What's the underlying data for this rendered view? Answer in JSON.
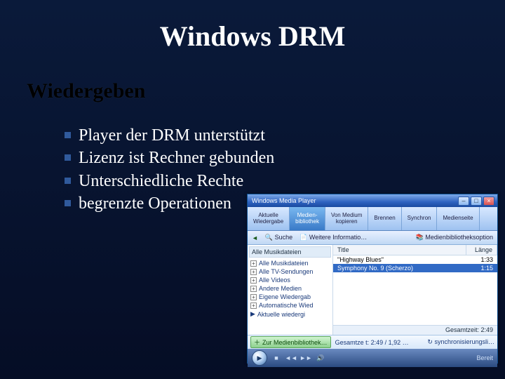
{
  "slide": {
    "title": "Windows DRM",
    "subtitle": "Wiedergeben",
    "bullets": [
      "Player der DRM unterstützt",
      "Lizenz ist Rechner gebunden",
      "Unterschiedliche Rechte",
      "begrenzte Operationen"
    ]
  },
  "wmp": {
    "window_title": "Windows Media Player",
    "win_min": "–",
    "win_max": "□",
    "win_close": "×",
    "tabs": {
      "t0a": "Aktuelle",
      "t0b": "Wiedergabe",
      "t1a": "Medien-",
      "t1b": "bibliothek",
      "t2a": "Von Medium",
      "t2b": "kopieren",
      "t3": "Brennen",
      "t4": "Synchron",
      "t5": "Medienseite"
    },
    "toolbar": {
      "back_glyph": "◄",
      "search_label": "Suche",
      "more_info": "Weitere Informatio…",
      "options": "Medienbibliotheksoption"
    },
    "side": {
      "header": "Alle Musikdateien",
      "items": [
        "Alle Musikdateien",
        "Alle TV-Sendungen",
        "Alle Videos",
        "Andere Medien",
        "Eigene Wiedergab",
        "Automatische Wied",
        "Aktuelle wiedergi"
      ]
    },
    "columns": {
      "title": "Title",
      "length": "Länge"
    },
    "rows": [
      {
        "title": "\"Highway Blues\"",
        "length": "1:33"
      },
      {
        "title": "Symphony No. 9 (Scherzo)",
        "length": "1:15"
      }
    ],
    "status_total": "Gesamtzeit: 2:49",
    "action": {
      "add": "Zur Medienbibliothek…",
      "total": "Gesamtze t: 2:49 / 1,92 …",
      "sync_glyph": "↻",
      "sync_label": "synchronisierungsli…"
    },
    "controls": {
      "play_glyph": "▶",
      "stop_glyph": "■",
      "prev_glyph": "◄◄",
      "next_glyph": "►►",
      "mute_glyph": "🔊",
      "status": "Bereit"
    }
  }
}
